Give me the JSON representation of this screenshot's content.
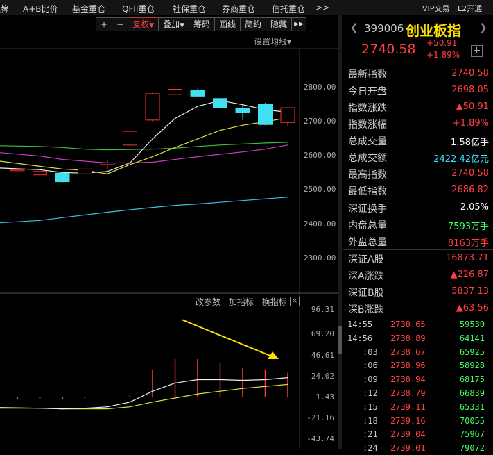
{
  "topbar": {
    "tabs": [
      "牌",
      "A+B比价",
      "基金重仓",
      "QFII重仓",
      "社保重仓",
      "券商重仓",
      "信托重仓",
      ">>"
    ],
    "vip": "VIP交易",
    "l2": "L2开通"
  },
  "toolbar": {
    "plus": "+",
    "minus": "−",
    "fuquan": "复权",
    "fuquan_arrow": "▼",
    "diejia": "叠加",
    "diejia_arrow": "▼",
    "chouma": "筹码",
    "huaxian": "画线",
    "jianyue": "简约",
    "yincang": "隐藏",
    "more": "▶▶"
  },
  "chart": {
    "setting": "设置均线",
    "setting_arrow": "▾",
    "price_axis": [
      "2800.00",
      "2700.00",
      "2600.00",
      "2500.00",
      "2400.00",
      "2300.00"
    ],
    "ind_tools": [
      "改参数",
      "加指标",
      "换指标"
    ],
    "close": "×",
    "sub_axis": [
      "96.31",
      "69.20",
      "46.61",
      "24.02",
      "1.43",
      "-21.16",
      "-43.74"
    ]
  },
  "chart_data": {
    "type": "candlestick",
    "price_ylim": [
      2200,
      2900
    ],
    "candles": [
      {
        "o": 2560,
        "c": 2560,
        "h": 2565,
        "l": 2555
      },
      {
        "o": 2545,
        "c": 2555,
        "h": 2558,
        "l": 2540
      },
      {
        "o": 2550,
        "c": 2525,
        "h": 2552,
        "l": 2520
      },
      {
        "o": 2548,
        "c": 2562,
        "h": 2568,
        "l": 2530
      },
      {
        "o": 2575,
        "c": 2580,
        "h": 2590,
        "l": 2560
      },
      {
        "o": 2632,
        "c": 2672,
        "h": 2675,
        "l": 2630
      },
      {
        "o": 2705,
        "c": 2782,
        "h": 2785,
        "l": 2700
      },
      {
        "o": 2780,
        "c": 2795,
        "h": 2800,
        "l": 2760
      },
      {
        "o": 2792,
        "c": 2775,
        "h": 2797,
        "l": 2772
      },
      {
        "o": 2768,
        "c": 2742,
        "h": 2772,
        "l": 2740
      },
      {
        "o": 2740,
        "c": 2728,
        "h": 2752,
        "l": 2705
      },
      {
        "o": 2752,
        "c": 2692,
        "h": 2755,
        "l": 2690
      },
      {
        "o": 2698,
        "c": 2741,
        "h": 2743,
        "l": 2687
      }
    ],
    "ma_short": [
      2565,
      2560,
      2552,
      2550,
      2555,
      2580,
      2650,
      2710,
      2745,
      2762,
      2750,
      2735,
      2728
    ],
    "ma_mid": [
      2585,
      2570,
      2562,
      2558,
      2548,
      2575,
      2598,
      2625,
      2650,
      2675,
      2690,
      2700,
      2712
    ],
    "ma_green": [
      2630,
      2628,
      2625,
      2620,
      2618,
      2619,
      2620,
      2623,
      2628,
      2632,
      2635,
      2638,
      2640
    ],
    "ma_magenta": [
      2610,
      2600,
      2590,
      2585,
      2580,
      2580,
      2582,
      2590,
      2598,
      2605,
      2612,
      2620,
      2632
    ],
    "ma_cyan": [
      2405,
      2412,
      2420,
      2428,
      2436,
      2443,
      2450,
      2456,
      2460,
      2465,
      2470,
      2475,
      2480
    ],
    "sub_ylim": [
      -50,
      100
    ],
    "sub_bars": [
      -3,
      -3,
      -3,
      -2,
      0,
      2,
      40,
      55,
      55,
      50,
      42,
      40,
      35
    ],
    "sub_line_white": [
      -16,
      -17,
      -18,
      -17,
      -15,
      -8,
      8,
      20,
      25,
      25,
      24,
      25,
      28
    ],
    "sub_line_yellow": [
      -17,
      -17,
      -18,
      -18,
      -18,
      -15,
      -8,
      -2,
      4,
      8,
      12,
      15,
      18
    ]
  },
  "header": {
    "code": "399006",
    "name": "创业板指",
    "price": "2740.58",
    "change": "+50.91",
    "pct": "+1.89%",
    "plus": "+"
  },
  "quote": {
    "group1": [
      {
        "k": "最新指数",
        "v": "2740.58",
        "c": "red"
      },
      {
        "k": "今日开盘",
        "v": "2698.05",
        "c": "red"
      },
      {
        "k": "指数涨跌",
        "v": "▲50.91",
        "c": "red"
      },
      {
        "k": "指数涨幅",
        "v": "+1.89%",
        "c": "red"
      },
      {
        "k": "总成交量",
        "v": "1.58亿手",
        "c": "white"
      },
      {
        "k": "总成交额",
        "v": "2422.42亿元",
        "c": "cyan"
      },
      {
        "k": "最高指数",
        "v": "2740.58",
        "c": "red"
      },
      {
        "k": "最低指数",
        "v": "2686.82",
        "c": "red"
      }
    ],
    "group2": [
      {
        "k": "深证换手",
        "v": "2.05%",
        "c": "white"
      },
      {
        "k": "内盘总量",
        "v": "7593万手",
        "c": "green"
      },
      {
        "k": "外盘总量",
        "v": "8163万手",
        "c": "red"
      }
    ],
    "group3": [
      {
        "k": "深证A股",
        "v": "16873.71",
        "c": "red"
      },
      {
        "k": "深A涨跌",
        "v": "▲226.87",
        "c": "red"
      },
      {
        "k": "深证B股",
        "v": "5837.13",
        "c": "red"
      },
      {
        "k": "深B涨跌",
        "v": "▲63.56",
        "c": "red"
      }
    ]
  },
  "ticks": [
    {
      "t": "14:55",
      "p": "2738.65",
      "v": "59530"
    },
    {
      "t": "14:56",
      "p": "2738.89",
      "v": "64141"
    },
    {
      "t": ":03",
      "p": "2738.67",
      "v": "65925"
    },
    {
      "t": ":06",
      "p": "2738.96",
      "v": "58928"
    },
    {
      "t": ":09",
      "p": "2738.94",
      "v": "68175"
    },
    {
      "t": ":12",
      "p": "2738.79",
      "v": "66839"
    },
    {
      "t": ":15",
      "p": "2739.11",
      "v": "65331"
    },
    {
      "t": ":18",
      "p": "2739.16",
      "v": "70055"
    },
    {
      "t": ":21",
      "p": "2739.04",
      "v": "75967"
    },
    {
      "t": ":24",
      "p": "2739.01",
      "v": "79072"
    }
  ]
}
